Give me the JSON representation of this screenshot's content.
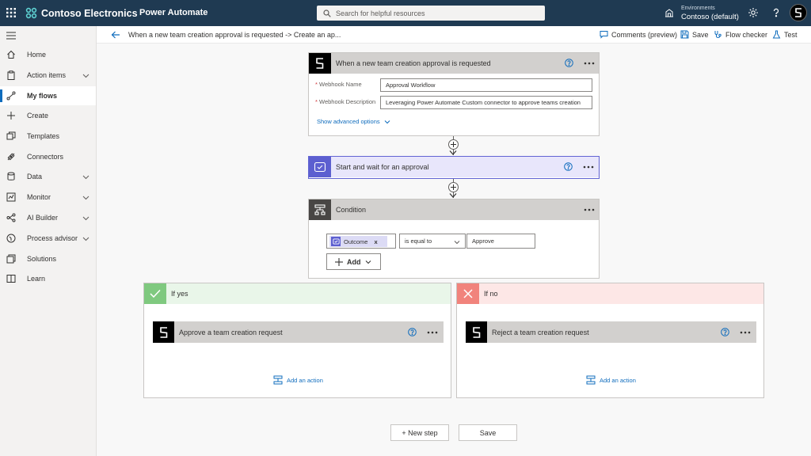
{
  "topbar": {
    "org_name": "Contoso Electronics",
    "product_name": "Power Automate",
    "search_placeholder": "Search for helpful resources",
    "environments_label": "Environments",
    "environment_value": "Contoso (default)",
    "bg_color": "#1f3a52"
  },
  "cmdbar": {
    "breadcrumb": "When a new team creation approval is requested -> Create an ap...",
    "comments_label": "Comments (preview)",
    "save_label": "Save",
    "flow_checker_label": "Flow checker",
    "test_label": "Test"
  },
  "sidebar": {
    "items": [
      {
        "label": "Home",
        "icon": "home-icon"
      },
      {
        "label": "Action items",
        "icon": "clipboard-icon",
        "has_chevron": true
      },
      {
        "label": "My flows",
        "icon": "flow-icon",
        "active": true
      },
      {
        "label": "Create",
        "icon": "plus-icon"
      },
      {
        "label": "Templates",
        "icon": "templates-icon"
      },
      {
        "label": "Connectors",
        "icon": "connector-icon"
      },
      {
        "label": "Data",
        "icon": "database-icon",
        "has_chevron": true
      },
      {
        "label": "Monitor",
        "icon": "monitor-icon",
        "has_chevron": true
      },
      {
        "label": "AI Builder",
        "icon": "ai-builder-icon",
        "has_chevron": true
      },
      {
        "label": "Process advisor",
        "icon": "process-advisor-icon",
        "has_chevron": true
      },
      {
        "label": "Solutions",
        "icon": "solutions-icon"
      },
      {
        "label": "Learn",
        "icon": "book-icon"
      }
    ]
  },
  "trigger": {
    "title": "When a new team creation approval is requested",
    "webhook_name_label": "Webhook Name",
    "webhook_name_value": "Approval Workflow",
    "webhook_desc_label": "Webhook Description",
    "webhook_desc_value": "Leveraging Power Automate Custom connector to approve teams creation",
    "show_advanced": "Show advanced options",
    "required_mark": "*"
  },
  "approval": {
    "title": "Start and wait for an approval"
  },
  "condition": {
    "title": "Condition",
    "token_label": "Outcome",
    "token_remove": "x",
    "operator_value": "is equal to",
    "value": "Approve",
    "add_label": "Add"
  },
  "if_yes": {
    "title": "If yes",
    "action_title": "Approve a team creation request",
    "add_action": "Add an action",
    "color": "#7fc97f"
  },
  "if_no": {
    "title": "If no",
    "action_title": "Reject a team creation request",
    "add_action": "Add an action",
    "color": "#f1837c"
  },
  "footer": {
    "new_step_label": "+ New step",
    "save_label": "Save"
  },
  "colors": {
    "approval_header": "#e8e6fb",
    "approval_border": "#6264d3",
    "link": "#0f6cbd"
  }
}
